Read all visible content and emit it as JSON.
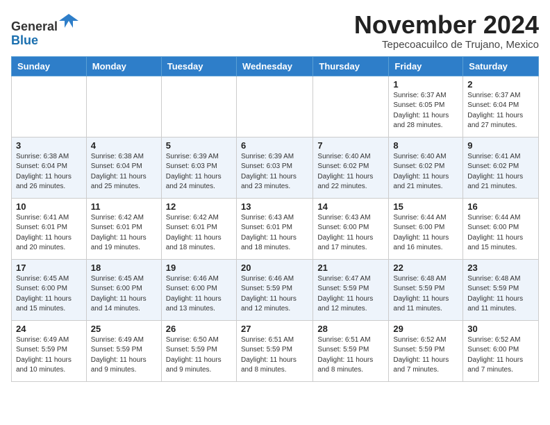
{
  "header": {
    "logo_line1": "General",
    "logo_line2": "Blue",
    "month_title": "November 2024",
    "location": "Tepecoacuilco de Trujano, Mexico"
  },
  "weekdays": [
    "Sunday",
    "Monday",
    "Tuesday",
    "Wednesday",
    "Thursday",
    "Friday",
    "Saturday"
  ],
  "weeks": [
    [
      {
        "day": "",
        "info": ""
      },
      {
        "day": "",
        "info": ""
      },
      {
        "day": "",
        "info": ""
      },
      {
        "day": "",
        "info": ""
      },
      {
        "day": "",
        "info": ""
      },
      {
        "day": "1",
        "info": "Sunrise: 6:37 AM\nSunset: 6:05 PM\nDaylight: 11 hours and 28 minutes."
      },
      {
        "day": "2",
        "info": "Sunrise: 6:37 AM\nSunset: 6:04 PM\nDaylight: 11 hours and 27 minutes."
      }
    ],
    [
      {
        "day": "3",
        "info": "Sunrise: 6:38 AM\nSunset: 6:04 PM\nDaylight: 11 hours and 26 minutes."
      },
      {
        "day": "4",
        "info": "Sunrise: 6:38 AM\nSunset: 6:04 PM\nDaylight: 11 hours and 25 minutes."
      },
      {
        "day": "5",
        "info": "Sunrise: 6:39 AM\nSunset: 6:03 PM\nDaylight: 11 hours and 24 minutes."
      },
      {
        "day": "6",
        "info": "Sunrise: 6:39 AM\nSunset: 6:03 PM\nDaylight: 11 hours and 23 minutes."
      },
      {
        "day": "7",
        "info": "Sunrise: 6:40 AM\nSunset: 6:02 PM\nDaylight: 11 hours and 22 minutes."
      },
      {
        "day": "8",
        "info": "Sunrise: 6:40 AM\nSunset: 6:02 PM\nDaylight: 11 hours and 21 minutes."
      },
      {
        "day": "9",
        "info": "Sunrise: 6:41 AM\nSunset: 6:02 PM\nDaylight: 11 hours and 21 minutes."
      }
    ],
    [
      {
        "day": "10",
        "info": "Sunrise: 6:41 AM\nSunset: 6:01 PM\nDaylight: 11 hours and 20 minutes."
      },
      {
        "day": "11",
        "info": "Sunrise: 6:42 AM\nSunset: 6:01 PM\nDaylight: 11 hours and 19 minutes."
      },
      {
        "day": "12",
        "info": "Sunrise: 6:42 AM\nSunset: 6:01 PM\nDaylight: 11 hours and 18 minutes."
      },
      {
        "day": "13",
        "info": "Sunrise: 6:43 AM\nSunset: 6:01 PM\nDaylight: 11 hours and 18 minutes."
      },
      {
        "day": "14",
        "info": "Sunrise: 6:43 AM\nSunset: 6:00 PM\nDaylight: 11 hours and 17 minutes."
      },
      {
        "day": "15",
        "info": "Sunrise: 6:44 AM\nSunset: 6:00 PM\nDaylight: 11 hours and 16 minutes."
      },
      {
        "day": "16",
        "info": "Sunrise: 6:44 AM\nSunset: 6:00 PM\nDaylight: 11 hours and 15 minutes."
      }
    ],
    [
      {
        "day": "17",
        "info": "Sunrise: 6:45 AM\nSunset: 6:00 PM\nDaylight: 11 hours and 15 minutes."
      },
      {
        "day": "18",
        "info": "Sunrise: 6:45 AM\nSunset: 6:00 PM\nDaylight: 11 hours and 14 minutes."
      },
      {
        "day": "19",
        "info": "Sunrise: 6:46 AM\nSunset: 6:00 PM\nDaylight: 11 hours and 13 minutes."
      },
      {
        "day": "20",
        "info": "Sunrise: 6:46 AM\nSunset: 5:59 PM\nDaylight: 11 hours and 12 minutes."
      },
      {
        "day": "21",
        "info": "Sunrise: 6:47 AM\nSunset: 5:59 PM\nDaylight: 11 hours and 12 minutes."
      },
      {
        "day": "22",
        "info": "Sunrise: 6:48 AM\nSunset: 5:59 PM\nDaylight: 11 hours and 11 minutes."
      },
      {
        "day": "23",
        "info": "Sunrise: 6:48 AM\nSunset: 5:59 PM\nDaylight: 11 hours and 11 minutes."
      }
    ],
    [
      {
        "day": "24",
        "info": "Sunrise: 6:49 AM\nSunset: 5:59 PM\nDaylight: 11 hours and 10 minutes."
      },
      {
        "day": "25",
        "info": "Sunrise: 6:49 AM\nSunset: 5:59 PM\nDaylight: 11 hours and 9 minutes."
      },
      {
        "day": "26",
        "info": "Sunrise: 6:50 AM\nSunset: 5:59 PM\nDaylight: 11 hours and 9 minutes."
      },
      {
        "day": "27",
        "info": "Sunrise: 6:51 AM\nSunset: 5:59 PM\nDaylight: 11 hours and 8 minutes."
      },
      {
        "day": "28",
        "info": "Sunrise: 6:51 AM\nSunset: 5:59 PM\nDaylight: 11 hours and 8 minutes."
      },
      {
        "day": "29",
        "info": "Sunrise: 6:52 AM\nSunset: 5:59 PM\nDaylight: 11 hours and 7 minutes."
      },
      {
        "day": "30",
        "info": "Sunrise: 6:52 AM\nSunset: 6:00 PM\nDaylight: 11 hours and 7 minutes."
      }
    ]
  ]
}
